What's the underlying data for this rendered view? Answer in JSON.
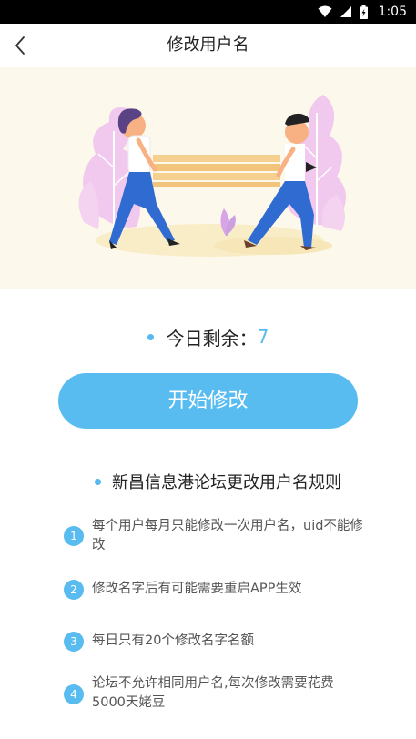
{
  "status_bar": {
    "time": "1:05"
  },
  "nav": {
    "title": "修改用户名"
  },
  "remaining": {
    "label": "今日剩余：",
    "value": "7"
  },
  "start_button": {
    "label": "开始修改"
  },
  "rules": {
    "title": "新昌信息港论坛更改用户名规则",
    "items": [
      {
        "num": "1",
        "text": "每个用户每月只能修改一次用户名，uid不能修改"
      },
      {
        "num": "2",
        "text": "修改名字后有可能需要重启APP生效"
      },
      {
        "num": "3",
        "text": "每日只有20个修改名字名额"
      },
      {
        "num": "4",
        "text": "论坛不允许相同用户名,每次修改需要花费5000天姥豆"
      }
    ]
  },
  "colors": {
    "accent": "#58bcf0",
    "banner_bg": "#fdf8ec",
    "status_bar": "#000000"
  }
}
